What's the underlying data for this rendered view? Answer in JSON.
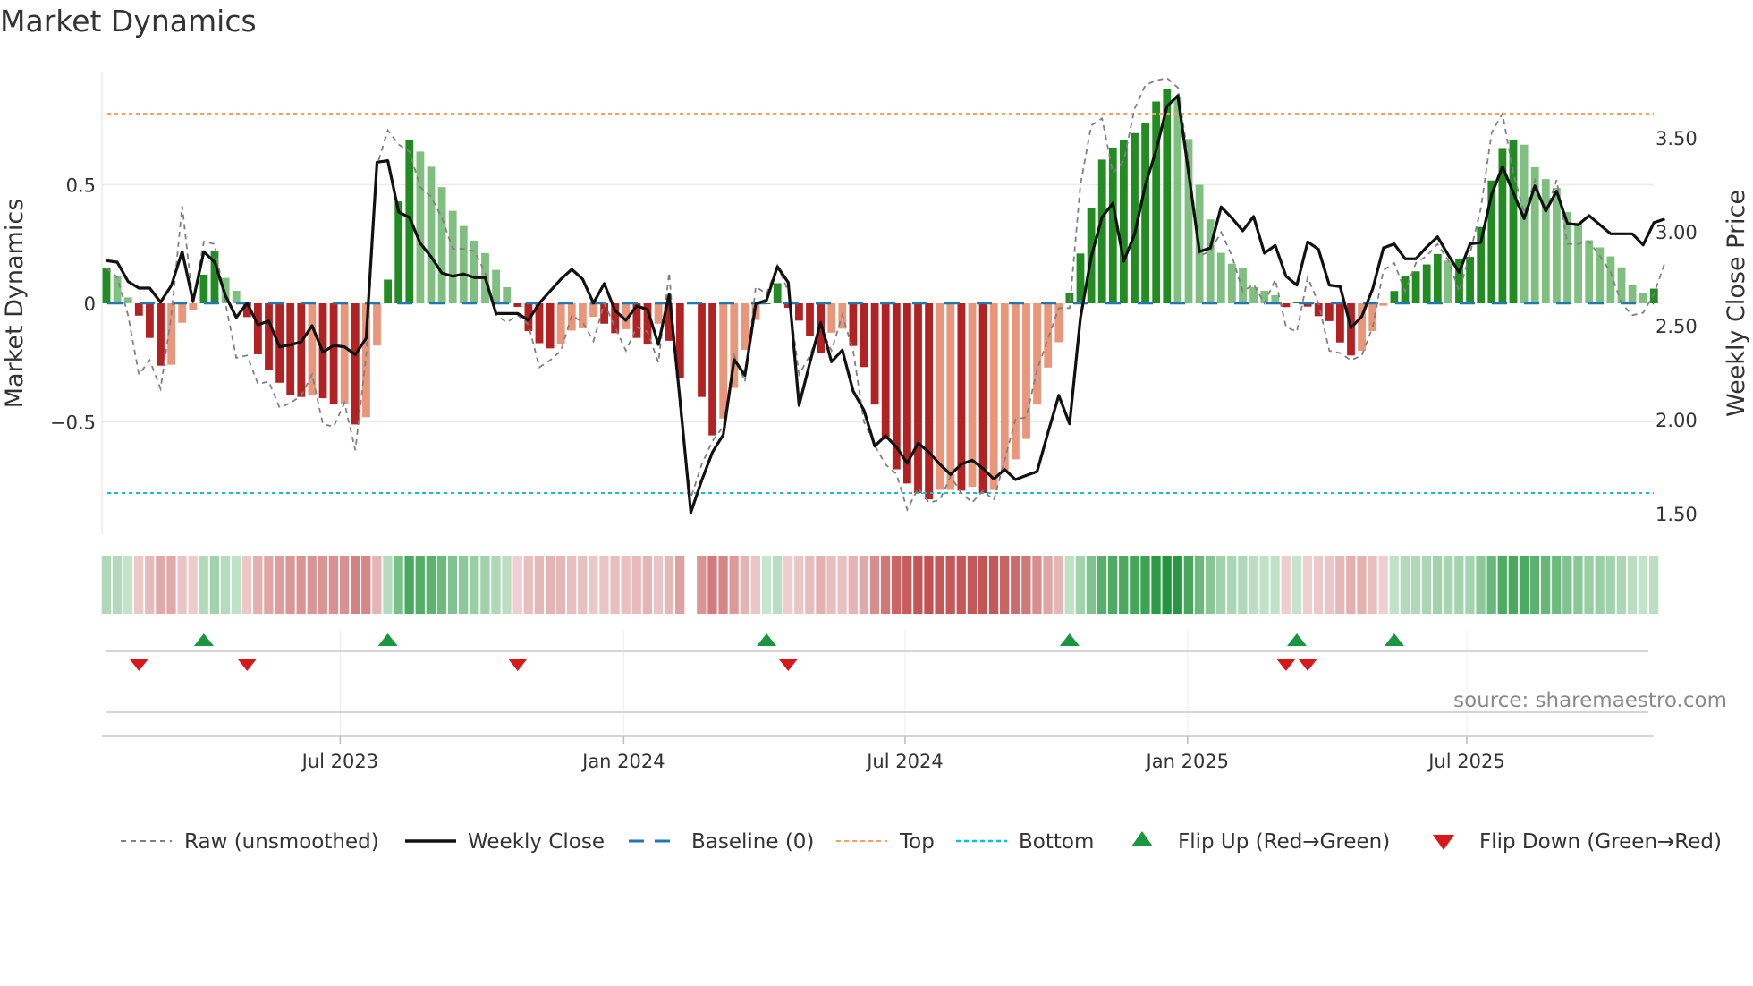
{
  "title": "Market Dynamics",
  "source": "source: sharemaestro.com",
  "colors": {
    "up_strong": "#228b22",
    "up_weak": "#7fbf7f",
    "down_strong": "#b22222",
    "down_weak": "#e9967a",
    "close": "#111111",
    "raw": "#808080",
    "baseline": "#1f77b4",
    "top": "#f4a261",
    "bottom": "#17becf",
    "flip_up": "#1a9641",
    "flip_down": "#d7191c"
  },
  "legend": [
    {
      "key": "raw",
      "label": "Raw (unsmoothed)"
    },
    {
      "key": "close",
      "label": "Weekly Close"
    },
    {
      "key": "baseline",
      "label": "Baseline (0)"
    },
    {
      "key": "top",
      "label": "Top"
    },
    {
      "key": "bottom",
      "label": "Bottom"
    },
    {
      "key": "flip_up",
      "label": "Flip Up (Red→Green)"
    },
    {
      "key": "flip_down",
      "label": "Flip Down (Green→Red)"
    }
  ],
  "chart_data": {
    "type": "bar",
    "title": "Market Dynamics",
    "ylabel": "Market Dynamics",
    "y2label": "Weekly Close Price",
    "ylim": [
      -0.95,
      1.0
    ],
    "y2lim": [
      1.4,
      3.86
    ],
    "yticks": [
      {
        "value": 0.5,
        "label": "0.5"
      },
      {
        "value": 0,
        "label": "0"
      },
      {
        "value": -0.5,
        "label": "−0.5"
      }
    ],
    "y2ticks": [
      {
        "value": 3.5,
        "label": "3.50"
      },
      {
        "value": 3.0,
        "label": "3.00"
      },
      {
        "value": 2.5,
        "label": "2.50"
      },
      {
        "value": 2.0,
        "label": "2.00"
      },
      {
        "value": 1.5,
        "label": "1.50"
      }
    ],
    "xticks": [
      {
        "week": 21.6,
        "label": "Jul 2023"
      },
      {
        "week": 47.8,
        "label": "Jan 2024"
      },
      {
        "week": 73.8,
        "label": "Jul 2024"
      },
      {
        "week": 99.9,
        "label": "Jan 2025"
      },
      {
        "week": 125.7,
        "label": "Jul 2025"
      }
    ],
    "thresholds": {
      "top": 0.8,
      "bottom": -0.8,
      "baseline": 0
    },
    "momentum": [
      0.148,
      0.115,
      0.025,
      -0.052,
      -0.146,
      -0.263,
      -0.259,
      -0.082,
      -0.03,
      0.121,
      0.221,
      0.107,
      0.053,
      -0.058,
      -0.215,
      -0.282,
      -0.335,
      -0.388,
      -0.395,
      -0.389,
      -0.4,
      -0.424,
      -0.424,
      -0.511,
      -0.48,
      -0.178,
      0.1,
      0.43,
      0.69,
      0.64,
      0.576,
      0.49,
      0.39,
      0.326,
      0.264,
      0.212,
      0.141,
      0.068,
      -0.015,
      -0.117,
      -0.168,
      -0.19,
      -0.17,
      -0.115,
      -0.105,
      -0.057,
      -0.086,
      -0.126,
      -0.109,
      -0.146,
      -0.174,
      -0.086,
      -0.158,
      -0.317,
      null,
      -0.395,
      -0.557,
      -0.486,
      -0.357,
      -0.196,
      -0.07,
      0,
      0.085,
      -0.019,
      -0.073,
      -0.136,
      -0.208,
      -0.124,
      -0.107,
      -0.18,
      -0.269,
      -0.427,
      -0.574,
      -0.7,
      -0.76,
      -0.8,
      -0.827,
      -0.787,
      -0.787,
      -0.79,
      -0.774,
      -0.8,
      -0.787,
      -0.71,
      -0.658,
      -0.572,
      -0.427,
      -0.271,
      -0.164,
      0.044,
      0.21,
      0.4,
      0.606,
      0.657,
      0.688,
      0.718,
      0.759,
      0.851,
      0.905,
      0.871,
      0.693,
      0.5,
      0.354,
      0.213,
      0.167,
      0.148,
      0.068,
      0.053,
      0.034,
      -0.016,
      0.006,
      -0.014,
      -0.054,
      -0.075,
      -0.165,
      -0.22,
      -0.2,
      -0.117,
      -0.01,
      0.052,
      0.116,
      0.135,
      0.164,
      0.208,
      0.18,
      0.186,
      0.196,
      0.322,
      0.518,
      0.655,
      0.687,
      0.669,
      0.574,
      0.524,
      0.487,
      0.385,
      0.341,
      0.266,
      0.236,
      0.198,
      0.152,
      0.077,
      0.042,
      0.062
    ],
    "raw": [
      0.148,
      0.11,
      -0.05,
      -0.3,
      -0.24,
      -0.36,
      -0.05,
      0.41,
      0.0,
      0.26,
      0.25,
      0.0,
      -0.23,
      -0.22,
      -0.34,
      -0.33,
      -0.44,
      -0.42,
      -0.39,
      -0.3,
      -0.51,
      -0.52,
      -0.42,
      -0.62,
      -0.22,
      0.58,
      0.73,
      0.67,
      0.64,
      0.49,
      0.45,
      0.36,
      0.23,
      0.23,
      0.22,
      0.13,
      -0.05,
      -0.08,
      -0.05,
      -0.09,
      -0.27,
      -0.24,
      -0.2,
      -0.05,
      -0.08,
      -0.16,
      0.0,
      -0.1,
      -0.2,
      -0.1,
      -0.12,
      -0.25,
      0.13,
      -0.45,
      -0.82,
      -0.68,
      -0.58,
      -0.52,
      -0.22,
      -0.33,
      0.07,
      0.04,
      0.16,
      0.05,
      -0.3,
      -0.22,
      -0.1,
      -0.2,
      -0.05,
      -0.2,
      -0.5,
      -0.6,
      -0.68,
      -0.72,
      -0.87,
      -0.78,
      -0.84,
      -0.83,
      -0.73,
      -0.8,
      -0.84,
      -0.79,
      -0.83,
      -0.66,
      -0.49,
      -0.48,
      -0.28,
      -0.15,
      -0.02,
      -0.02,
      0.5,
      0.75,
      0.78,
      0.55,
      0.6,
      0.82,
      0.92,
      0.94,
      0.95,
      0.91,
      0.6,
      0.2,
      0.22,
      0.3,
      0.2,
      0.05,
      0.08,
      0.0,
      0.1,
      -0.1,
      -0.12,
      0.11,
      0.0,
      -0.2,
      -0.21,
      -0.24,
      -0.22,
      -0.1,
      0.14,
      0.17,
      0.05,
      0.17,
      0.2,
      0.25,
      0.18,
      0.05,
      0.21,
      0.4,
      0.72,
      0.8,
      0.55,
      0.38,
      0.52,
      0.38,
      0.52,
      0.25,
      0.25,
      0.26,
      0.2,
      0.13,
      0.0,
      -0.05,
      -0.04,
      0.04,
      0.17
    ],
    "close": [
      2.846,
      2.838,
      2.735,
      2.7,
      2.7,
      2.625,
      2.714,
      2.894,
      2.63,
      2.894,
      2.838,
      2.66,
      2.544,
      2.62,
      2.505,
      2.525,
      2.387,
      2.398,
      2.414,
      2.5,
      2.359,
      2.395,
      2.387,
      2.346,
      2.433,
      3.37,
      3.378,
      3.105,
      3.076,
      2.938,
      2.867,
      2.78,
      2.763,
      2.775,
      2.756,
      2.756,
      2.565,
      2.565,
      2.565,
      2.53,
      2.62,
      2.684,
      2.748,
      2.8,
      2.748,
      2.62,
      2.724,
      2.58,
      2.529,
      2.605,
      2.586,
      2.4,
      2.668,
      2.105,
      1.506,
      1.676,
      1.827,
      1.92,
      2.32,
      2.236,
      2.616,
      2.636,
      2.814,
      2.73,
      2.076,
      2.303,
      2.517,
      2.308,
      2.37,
      2.152,
      2.05,
      1.859,
      1.914,
      1.854,
      1.768,
      1.875,
      1.827,
      1.763,
      1.708,
      1.763,
      1.784,
      1.74,
      1.684,
      1.735,
      1.681,
      1.703,
      1.724,
      1.93,
      2.129,
      1.978,
      2.541,
      2.867,
      3.078,
      3.152,
      2.843,
      2.986,
      3.248,
      3.435,
      3.668,
      3.724,
      3.311,
      2.894,
      2.914,
      3.132,
      3.073,
      3.005,
      3.081,
      2.886,
      2.927,
      2.763,
      2.716,
      2.946,
      2.906,
      2.716,
      2.708,
      2.489,
      2.549,
      2.695,
      2.914,
      2.935,
      2.856,
      2.856,
      2.919,
      2.973,
      2.875,
      2.784,
      2.935,
      2.943,
      3.2,
      3.346,
      3.208,
      3.07,
      3.244,
      3.11,
      3.216,
      3.044,
      3.037,
      3.086,
      3.037,
      2.989,
      2.989,
      2.989,
      2.93,
      3.049,
      3.068
    ],
    "flip_up_weeks": [
      9,
      26,
      61,
      89,
      110,
      119
    ],
    "flip_down_weeks": [
      3,
      13,
      38,
      63,
      109,
      111
    ],
    "legend_position": "bottom"
  }
}
